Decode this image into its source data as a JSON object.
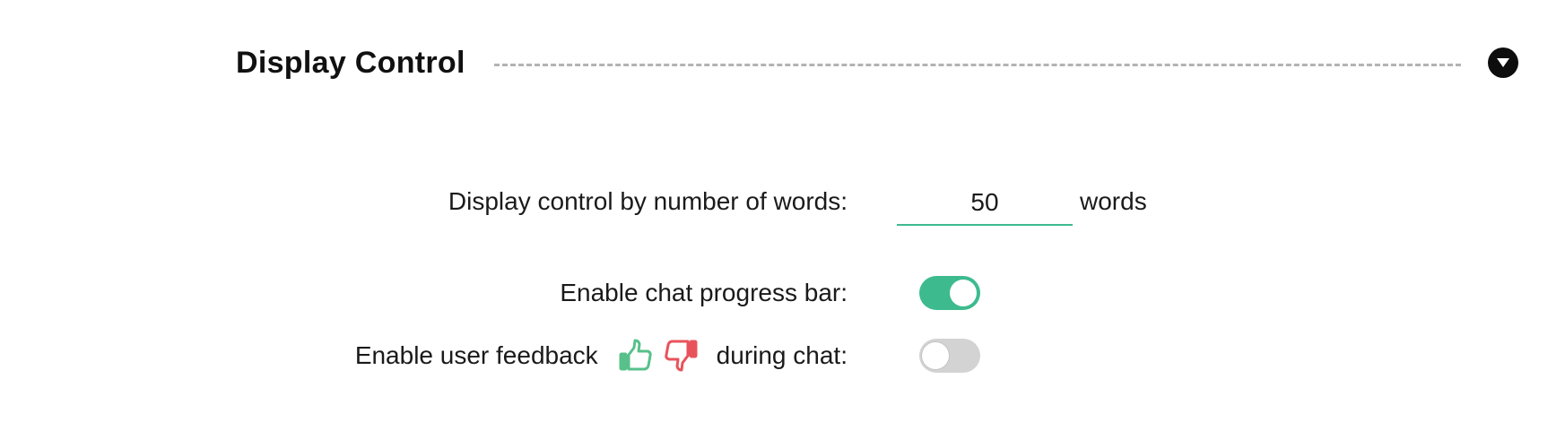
{
  "section": {
    "title": "Display Control"
  },
  "settings": {
    "word_limit": {
      "label": "Display control by number of words:",
      "value": "50",
      "unit": "words"
    },
    "chat_progress_bar": {
      "label": "Enable chat progress bar:",
      "enabled": true
    },
    "user_feedback": {
      "label_before": "Enable user feedback",
      "label_after": "during chat:",
      "enabled": false,
      "icons": [
        "thumbs-up-icon",
        "thumbs-down-icon"
      ]
    }
  },
  "colors": {
    "accent": "#3dbb8f",
    "toggle_off": "#d3d3d3",
    "thumbs_up": "#58c08a",
    "thumbs_down": "#e8535b",
    "divider": "#b3b3b3"
  }
}
